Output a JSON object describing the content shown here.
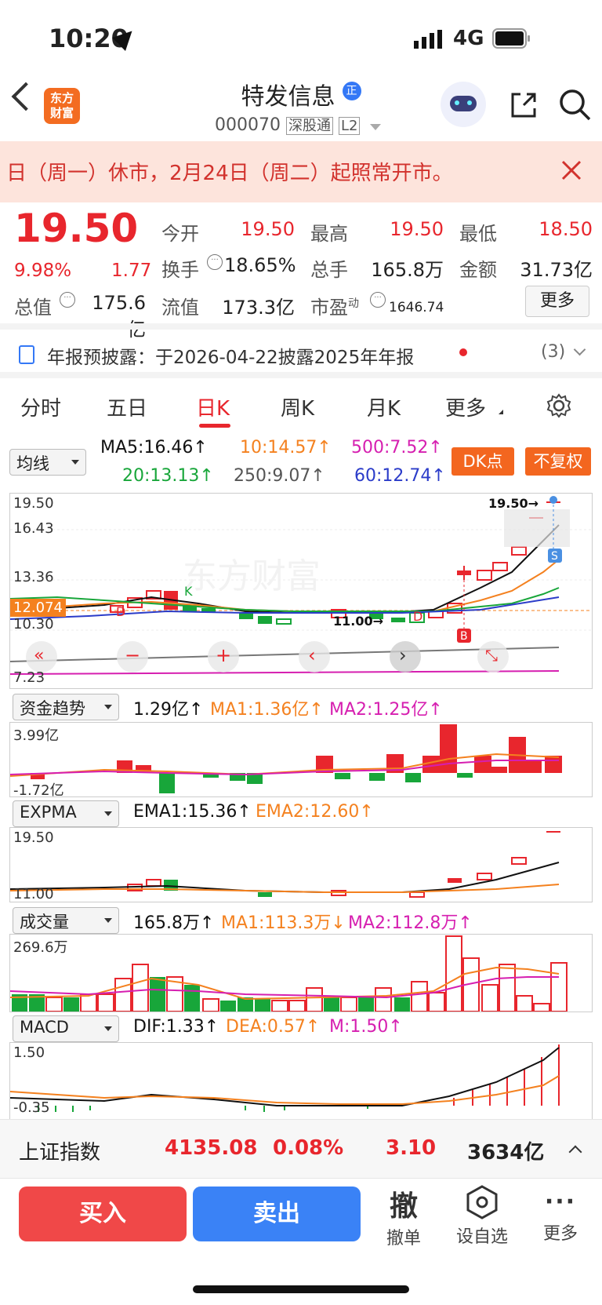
{
  "status_bar": {
    "time": "10:20",
    "network": "4G"
  },
  "header": {
    "logo_text_line1": "东方",
    "logo_text_line2": "财富",
    "stock_name": "特发信息",
    "badge": "正",
    "stock_code": "000070",
    "tag1": "深股通",
    "tag2": "L2"
  },
  "banner": {
    "text": "日（周一）休市，2月24日（周二）起照常开市。"
  },
  "quote": {
    "price": "19.50",
    "change_pct": "9.98%",
    "change": "1.77",
    "open_label": "今开",
    "open": "19.50",
    "high_label": "最高",
    "high": "19.50",
    "low_label": "最低",
    "low": "18.50",
    "turnover_label": "换手",
    "turnover": "18.65%",
    "volume_label": "总手",
    "volume": "165.8万",
    "amount_label": "金额",
    "amount": "31.73亿",
    "mktcap_label": "总值",
    "mktcap": "175.6亿",
    "float_label": "流值",
    "float": "173.3亿",
    "pe_label": "市盈",
    "pe_sup": "动",
    "pe": "1646.74",
    "more_button": "更多"
  },
  "notice": {
    "text": "年报预披露：于2026-04-22披露2025年年报",
    "count": "(3)"
  },
  "tabs": [
    {
      "label": "分时"
    },
    {
      "label": "五日"
    },
    {
      "label": "日K"
    },
    {
      "label": "周K"
    },
    {
      "label": "月K"
    },
    {
      "label": "更多"
    }
  ],
  "ma_legend": {
    "selector": "均线",
    "ma5": "MA5:16.46↑",
    "ma10": "10:14.57↑",
    "ma500": "500:7.52↑",
    "ma20": "20:13.13↑",
    "ma250": "250:9.07↑",
    "ma60": "60:12.74↑",
    "dk_button": "DK点",
    "fq_button": "不复权"
  },
  "kline_axis": {
    "y1": "19.50",
    "y2": "16.43",
    "y3": "13.36",
    "y4": "12.074",
    "y5": "10.30",
    "y6": "7.23",
    "last": "19.50→",
    "low_mark": "11.00→",
    "mark_d": "D",
    "mark_k": "K",
    "mark_s": "S",
    "mark_b": "B",
    "watermark": "东方财富"
  },
  "fund_panel": {
    "selector": "资金趋势",
    "value": "1.29亿↑",
    "ma1": "MA1:1.36亿↑",
    "ma2": "MA2:1.25亿↑",
    "top": "3.99亿",
    "bottom": "-1.72亿"
  },
  "expma_panel": {
    "selector": "EXPMA",
    "ema1": "EMA1:15.36↑",
    "ema2": "EMA2:12.60↑",
    "top": "19.50",
    "bottom": "11.00"
  },
  "volume_panel": {
    "selector": "成交量",
    "value": "165.8万↑",
    "ma1": "MA1:113.3万↓",
    "ma2": "MA2:112.8万↑",
    "top": "269.6万"
  },
  "macd_panel": {
    "selector": "MACD",
    "dif": "DIF:1.33↑",
    "dea": "DEA:0.57↑",
    "m": "M:1.50↑",
    "top": "1.50",
    "bottom": "-0.35"
  },
  "index_bar": {
    "name": "上证指数",
    "value": "4135.08",
    "pct": "0.08%",
    "change": "3.10",
    "amount": "3634亿"
  },
  "actions": {
    "buy": "买入",
    "sell": "卖出",
    "cancel_icon": "撤",
    "cancel": "撤单",
    "watch": "设自选",
    "more": "更多"
  },
  "colors": {
    "red": "#e8262d",
    "green": "#18a63a",
    "orange": "#f4811f",
    "blue": "#3478f6"
  }
}
